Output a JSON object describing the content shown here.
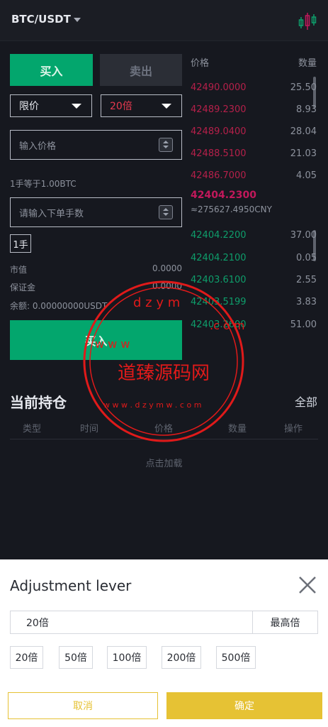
{
  "header": {
    "pair": "BTC/USDT"
  },
  "trade_tabs": {
    "buy": "买入",
    "sell": "卖出"
  },
  "order_type": {
    "selected": "限价"
  },
  "leverage_select": {
    "selected": "20倍"
  },
  "price_input": {
    "placeholder": "输入价格"
  },
  "lot_note": "1手等于1.00BTC",
  "qty_input": {
    "placeholder": "请输入下单手数"
  },
  "unit": "1手",
  "summary": {
    "market_value_label": "市值",
    "market_value": "0.0000",
    "margin_label": "保证金",
    "margin": "0.0000",
    "balance_label": "余额: 0.00000000USDT"
  },
  "buy_button": "买入",
  "orderbook": {
    "price_header": "价格",
    "qty_header": "数量",
    "asks": [
      {
        "price": "42490.0000",
        "qty": "25.50"
      },
      {
        "price": "42489.2300",
        "qty": "8.93"
      },
      {
        "price": "42489.0400",
        "qty": "28.04"
      },
      {
        "price": "42488.5100",
        "qty": "21.03"
      },
      {
        "price": "42486.7000",
        "qty": "4.05"
      }
    ],
    "mid_price": "42404.2300",
    "mid_cny": "≈275627.4950CNY",
    "bids": [
      {
        "price": "42404.2200",
        "qty": "37.00"
      },
      {
        "price": "42404.2100",
        "qty": "0.05"
      },
      {
        "price": "42403.6100",
        "qty": "2.55"
      },
      {
        "price": "42403.5199",
        "qty": "3.83"
      },
      {
        "price": "42403.2600",
        "qty": "51.00"
      }
    ]
  },
  "positions": {
    "title": "当前持仓",
    "all": "全部",
    "columns": [
      "类型",
      "时间",
      "价格",
      "数量",
      "操作"
    ],
    "empty": "点击加载"
  },
  "watermark": {
    "text": "道臻源码网",
    "url": "www.dzym.com"
  },
  "sheet": {
    "title": "Adjustment lever",
    "value": "20倍",
    "max_label": "最高倍",
    "chips": [
      "20倍",
      "50倍",
      "100倍",
      "200倍",
      "500倍"
    ],
    "cancel": "取消",
    "confirm": "确定"
  },
  "colors": {
    "buy": "#03a66d",
    "ask": "#b5204a",
    "bid": "#0e9e6b",
    "accent": "#e6c234",
    "watermark": "#e01a1a"
  }
}
